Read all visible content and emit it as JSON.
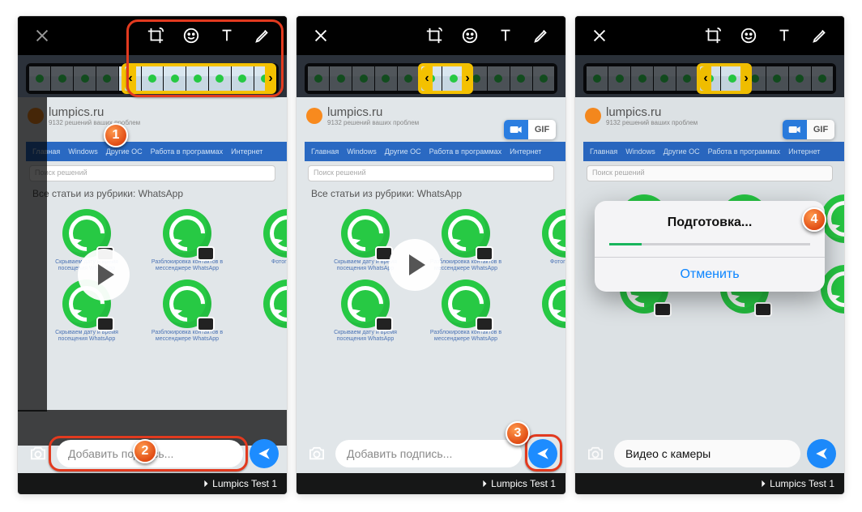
{
  "site": {
    "title": "lumpics.ru",
    "subtitle": "9132 решений ваших проблем",
    "nav": [
      "Главная",
      "Windows",
      "Другие ОС",
      "Работа в программах",
      "Интернет"
    ],
    "search_placeholder": "Поиск решений",
    "heading": "Все статьи из рубрики: WhatsApp",
    "cards": [
      "Скрываем дату и время посещения WhatsApp",
      "Разблокировка контактов в мессенджере WhatsApp",
      "Фотография",
      "Скрываем дату и время посещения WhatsApp",
      "Разблокировка контактов в мессенджере WhatsApp",
      ""
    ]
  },
  "caption_placeholder": "Добавить подпись...",
  "caption_value_3": "Видео с камеры",
  "gif_label": "GIF",
  "recipient": "Lumpics Test 1",
  "modal": {
    "title": "Подготовка...",
    "cancel": "Отменить"
  },
  "callouts": {
    "1": "1",
    "2": "2",
    "3": "3",
    "4": "4"
  }
}
